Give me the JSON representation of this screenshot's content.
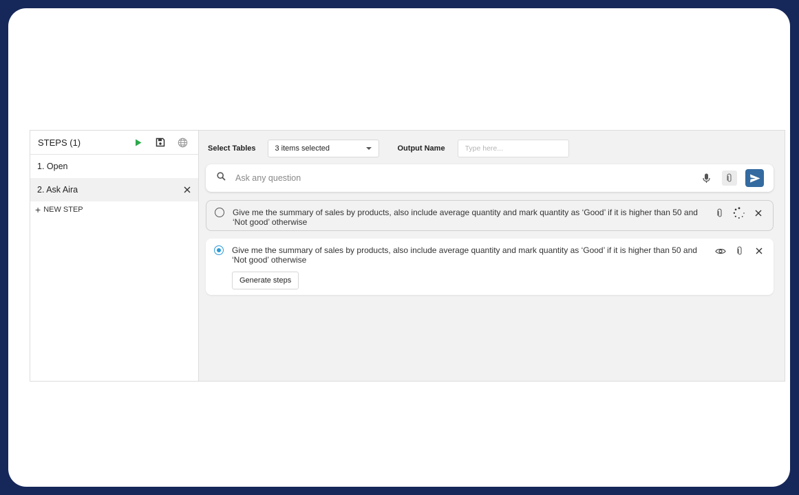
{
  "sidebar": {
    "title": "STEPS (1)",
    "steps": [
      {
        "label": "1. Open"
      },
      {
        "label": "2. Ask Aira"
      }
    ],
    "new_step_label": "NEW STEP"
  },
  "toolbar": {
    "select_tables_label": "Select Tables",
    "select_value": "3 items selected",
    "output_name_label": "Output Name",
    "output_placeholder": "Type here..."
  },
  "search": {
    "placeholder": "Ask any question"
  },
  "prompts": [
    {
      "text": "Give me the summary of sales by products, also include average quantity and mark quantity as ‘Good’ if it is higher than 50 and ‘Not good’ otherwise"
    },
    {
      "text": "Give me the summary of sales by products, also include average quantity and mark quantity as ‘Good’ if it is higher than 50 and ‘Not good’ otherwise",
      "button_label": "Generate steps"
    }
  ],
  "colors": {
    "frame": "#16275a",
    "accent": "#336aa0",
    "play": "#2ba84a",
    "radio_selected": "#2a9ad6"
  },
  "icons": [
    "play-icon",
    "save-icon",
    "globe-icon",
    "close-icon",
    "plus-icon",
    "caret-down-icon",
    "search-icon",
    "mic-icon",
    "paperclip-icon",
    "send-icon",
    "spinner-icon",
    "eye-icon"
  ]
}
